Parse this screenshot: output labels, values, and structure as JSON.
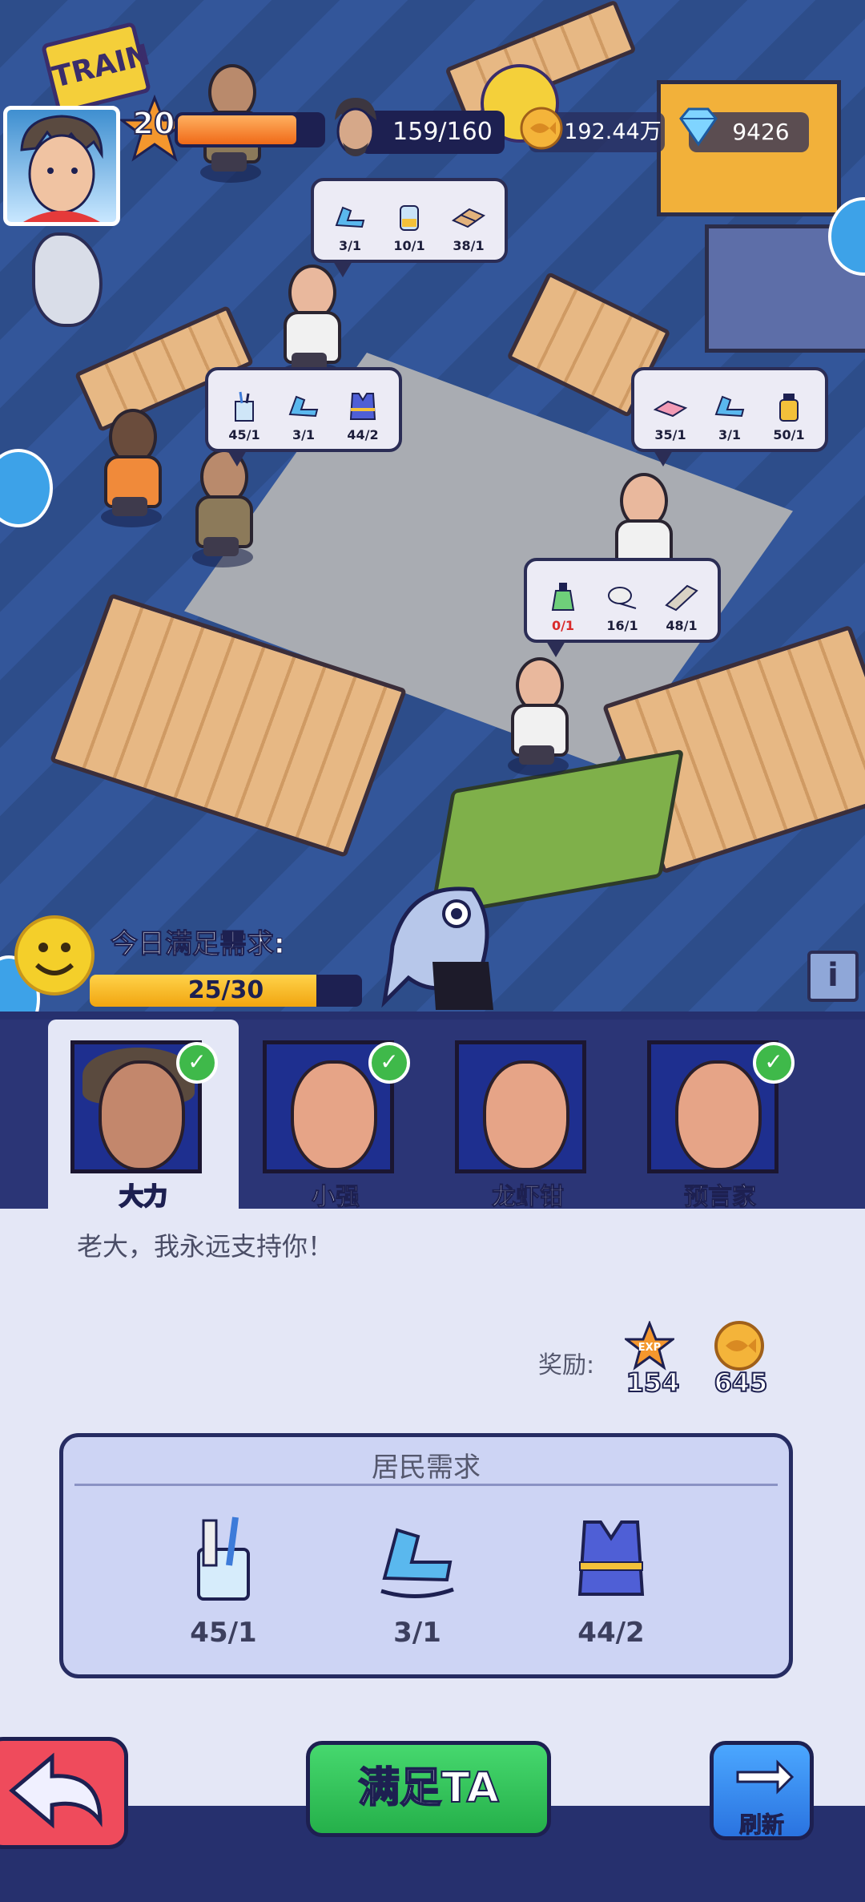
{
  "hud": {
    "level": "20",
    "xp_progress": 0.82,
    "population": "159/160",
    "coins": "192.44万",
    "gems": "9426"
  },
  "world": {
    "sign_text": "TRAIN",
    "bubbles": [
      {
        "items": [
          {
            "icon": "recliner-chair-icon",
            "count": "3/1"
          },
          {
            "icon": "water-jug-icon",
            "count": "10/1"
          },
          {
            "icon": "wood-planks-icon",
            "count": "38/1"
          }
        ]
      },
      {
        "items": [
          {
            "icon": "toothbrush-cup-icon",
            "count": "45/1"
          },
          {
            "icon": "recliner-chair-icon",
            "count": "3/1"
          },
          {
            "icon": "life-vest-icon",
            "count": "44/2"
          }
        ]
      },
      {
        "items": [
          {
            "icon": "bed-icon",
            "count": "35/1"
          },
          {
            "icon": "recliner-chair-icon",
            "count": "3/1"
          },
          {
            "icon": "bottle-icon",
            "count": "50/1"
          }
        ]
      },
      {
        "items": [
          {
            "icon": "potion-bottle-icon",
            "count": "0/1",
            "insufficient": true
          },
          {
            "icon": "toilet-paper-icon",
            "count": "16/1"
          },
          {
            "icon": "paper-roll-icon",
            "count": "48/1"
          }
        ]
      }
    ]
  },
  "daily": {
    "label": "今日满足需求:",
    "progress": "25/30",
    "fraction": 0.8333
  },
  "residents": [
    {
      "name": "大力",
      "satisfied": true,
      "active": true
    },
    {
      "name": "小强",
      "satisfied": true,
      "active": false
    },
    {
      "name": "龙虾钳",
      "satisfied": false,
      "active": false
    },
    {
      "name": "预言家",
      "satisfied": true,
      "active": false
    }
  ],
  "detail": {
    "quote": "老大，我永远支持你！",
    "reward_label": "奖励:",
    "reward_exp": "154",
    "reward_coins": "645",
    "exp_badge": "EXP"
  },
  "needs": {
    "title": "居民需求",
    "items": [
      {
        "icon": "toothbrush-cup-icon",
        "count": "45/1"
      },
      {
        "icon": "recliner-chair-icon",
        "count": "3/1"
      },
      {
        "icon": "life-vest-icon",
        "count": "44/2"
      }
    ]
  },
  "actions": {
    "satisfy_label": "满足TA",
    "refresh_label": "刷新"
  },
  "colors": {
    "panel_bg": "#26306e",
    "content_bg": "#e4e7f6",
    "satisfy_green": "#25b04a",
    "back_red": "#ef4b5c",
    "refresh_blue": "#2a73e0"
  }
}
